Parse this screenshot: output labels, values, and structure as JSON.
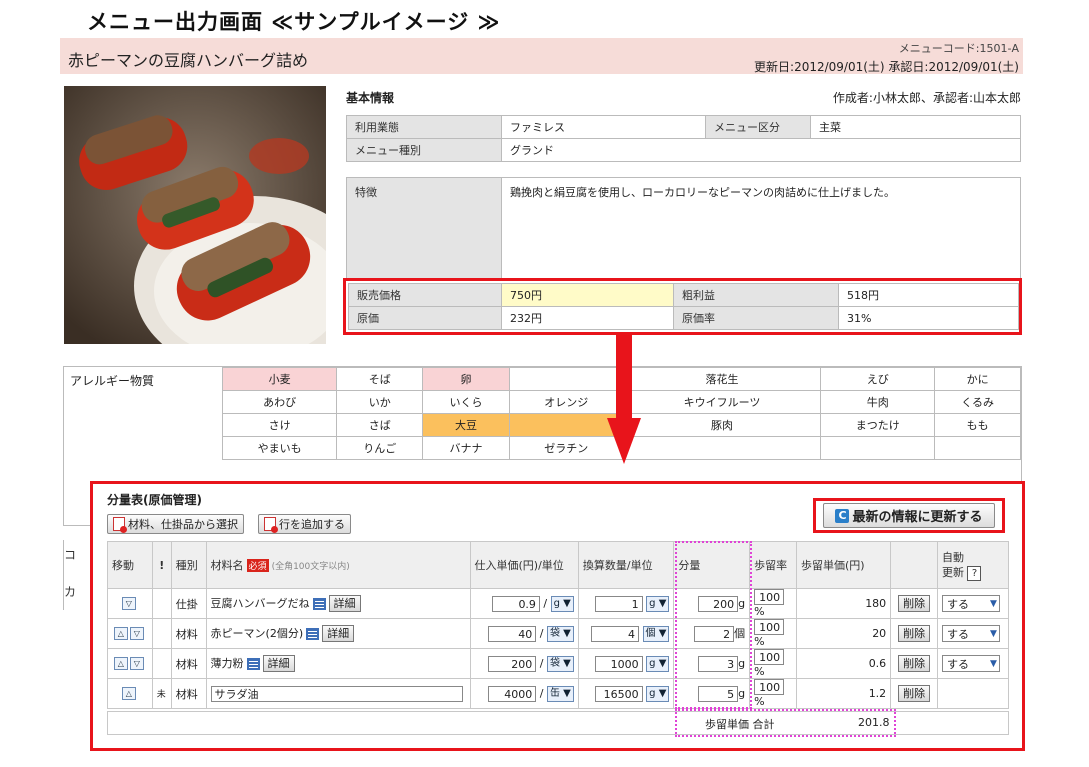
{
  "page_title": "メニュー出力画面 ≪サンプルイメージ ≫",
  "header": {
    "menu_name": "赤ピーマンの豆腐ハンバーグ詰め",
    "menu_code": "メニューコード:1501-A",
    "dates": "更新日:2012/09/01(土) 承認日:2012/09/01(土)"
  },
  "basic": {
    "section_title": "基本情報",
    "authors": "作成者:小林太郎、承認者:山本太郎",
    "usage_label": "利用業態",
    "usage_value": "ファミレス",
    "category_label": "メニュー区分",
    "category_value": "主菜",
    "type_label": "メニュー種別",
    "type_value": "グランド",
    "feature_label": "特徴",
    "feature_value": "鶏挽肉と絹豆腐を使用し、ローカロリーなピーマンの肉詰めに仕上げました。",
    "price_label": "販売価格",
    "price_value": "750円",
    "profit_label": "粗利益",
    "profit_value": "518円",
    "cost_label": "原価",
    "cost_value": "232円",
    "cost_rate_label": "原価率",
    "cost_rate_value": "31%"
  },
  "allergy": {
    "label": "アレルギー物質",
    "rows": [
      [
        "小麦",
        "そば",
        "卵",
        "",
        "落花生",
        "えび",
        "かに"
      ],
      [
        "あわび",
        "いか",
        "いくら",
        "オレンジ",
        "キウイフルーツ",
        "牛肉",
        "くるみ"
      ],
      [
        "さけ",
        "さば",
        "大豆",
        "",
        "豚肉",
        "まつたけ",
        "もも"
      ],
      [
        "やまいも",
        "りんご",
        "バナナ",
        "ゼラチン",
        "",
        "",
        ""
      ]
    ],
    "highlights": [
      [
        0,
        0,
        "pink"
      ],
      [
        0,
        2,
        "pink"
      ],
      [
        2,
        2,
        "orange"
      ]
    ]
  },
  "side_labels": [
    "コ",
    "カ"
  ],
  "recipe": {
    "title": "分量表(原価管理)",
    "btn_select": "材料、仕掛品から選択",
    "btn_add": "行を追加する",
    "btn_refresh": "最新の情報に更新する",
    "headers": {
      "move": "移動",
      "mark": "!",
      "kind": "種別",
      "name": "材料名",
      "required": "必須",
      "name_hint": "(全角100文字以内)",
      "unit_price": "仕入単価(円)/単位",
      "conv_qty": "換算数量/単位",
      "qty": "分量",
      "yield": "歩留率",
      "yield_price": "歩留単価(円)",
      "auto_update": "自動",
      "auto_update2": "更新",
      "help": "?"
    },
    "rows": [
      {
        "up": false,
        "down": true,
        "mark": "",
        "kind": "仕掛",
        "name": "豆腐ハンバーグだね",
        "detail": "詳細",
        "price": "0.9",
        "price_unit": "g",
        "conv": "1",
        "conv_unit": "g",
        "qty": "200",
        "qty_unit": "g",
        "yield": "100",
        "yield_pct": "%",
        "yprice": "180",
        "delete": "削除",
        "auto": "する"
      },
      {
        "up": true,
        "down": true,
        "mark": "",
        "kind": "材料",
        "name": "赤ピーマン(2個分)",
        "detail": "詳細",
        "price": "40",
        "price_unit": "袋",
        "conv": "4",
        "conv_unit": "個",
        "qty": "2",
        "qty_unit": "個",
        "yield": "100",
        "yield_pct": "%",
        "yprice": "20",
        "delete": "削除",
        "auto": "する"
      },
      {
        "up": true,
        "down": true,
        "mark": "",
        "kind": "材料",
        "name": "薄力粉",
        "detail": "詳細",
        "price": "200",
        "price_unit": "袋",
        "conv": "1000",
        "conv_unit": "g",
        "qty": "3",
        "qty_unit": "g",
        "yield": "100",
        "yield_pct": "%",
        "yprice": "0.6",
        "delete": "削除",
        "auto": "する"
      },
      {
        "up": true,
        "down": false,
        "mark": "未",
        "kind": "材料",
        "name": "サラダ油",
        "detail": "",
        "price": "4000",
        "price_unit": "缶",
        "conv": "16500",
        "conv_unit": "g",
        "qty": "5",
        "qty_unit": "g",
        "yield": "100",
        "yield_pct": "%",
        "yprice": "1.2",
        "delete": "削除",
        "auto": ""
      }
    ],
    "total_label": "歩留単価 合計",
    "total_value": "201.8"
  },
  "colors": {
    "accent_red": "#e8141b",
    "header_pink": "#f6dcd8",
    "highlight_pink": "#f9d3d5",
    "highlight_orange": "#fbc05d",
    "price_yellow": "#fffbc8",
    "dotted_magenta": "#e043d6"
  }
}
